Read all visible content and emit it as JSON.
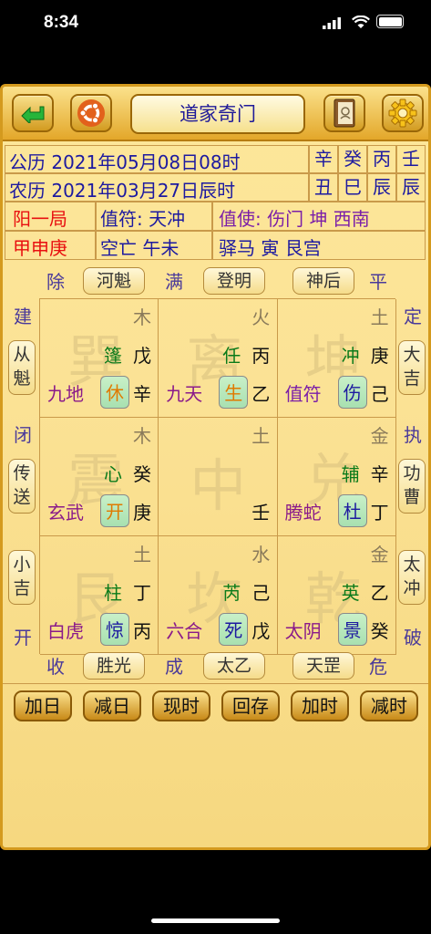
{
  "status": {
    "time": "8:34"
  },
  "title": "道家奇门",
  "row1": {
    "label": "公历 2021年05月08日08时",
    "c1": "辛",
    "c2": "癸",
    "c3": "丙",
    "c4": "壬"
  },
  "row2": {
    "label": "农历 2021年03月27日辰时",
    "c1": "丑",
    "c2": "巳",
    "c3": "辰",
    "c4": "辰"
  },
  "row3": {
    "ju": "阳一局",
    "zhifu": "值符: 天冲",
    "zhishi": "值使: 伤门 坤 西南"
  },
  "row4": {
    "xun": "甲申庚",
    "kongwang": "空亡 午未",
    "yima": "驿马 寅 艮宫"
  },
  "top": {
    "l1": "除",
    "b1": "河魁",
    "l2": "满",
    "b2": "登明",
    "b3": "神后",
    "l3": "平"
  },
  "bottom": {
    "l1": "收",
    "b1": "胜光",
    "l2": "成",
    "b2": "太乙",
    "b3": "天罡",
    "l3": "危"
  },
  "left": {
    "t1": "建",
    "b1": "从魁",
    "t2": "闭",
    "b2": "传送",
    "b3": "小吉",
    "t3": "开"
  },
  "right": {
    "t1": "定",
    "b1": "大吉",
    "t2": "执",
    "b2": "功曹",
    "b3": "太冲",
    "t3": "破"
  },
  "palaces": [
    {
      "wm": "巽",
      "el": "木",
      "star": "篷",
      "tg": "戊",
      "god": "九地",
      "door": "休",
      "dg": "辛",
      "doorColor": "#e07a00"
    },
    {
      "wm": "离",
      "el": "火",
      "star": "任",
      "tg": "丙",
      "god": "九天",
      "door": "生",
      "dg": "乙",
      "doorColor": "#e07a00"
    },
    {
      "wm": "坤",
      "el": "土",
      "star": "冲",
      "tg": "庚",
      "god": "值符",
      "door": "伤",
      "dg": "己",
      "doorColor": "#1d1aa0"
    },
    {
      "wm": "震",
      "el": "木",
      "star": "心",
      "tg": "癸",
      "god": "玄武",
      "door": "开",
      "dg": "庚",
      "doorColor": "#e07a00"
    },
    {
      "wm": "中",
      "el": "土",
      "star": "",
      "tg": "",
      "god": "",
      "door": "",
      "dg": "壬",
      "doorColor": ""
    },
    {
      "wm": "兑",
      "el": "金",
      "star": "辅",
      "tg": "辛",
      "god": "腾蛇",
      "door": "杜",
      "dg": "丁",
      "doorColor": "#1d1aa0"
    },
    {
      "wm": "艮",
      "el": "土",
      "star": "柱",
      "tg": "丁",
      "god": "白虎",
      "door": "惊",
      "dg": "丙",
      "doorColor": "#1d1aa0"
    },
    {
      "wm": "坎",
      "el": "水",
      "star": "芮",
      "tg": "己",
      "god": "六合",
      "door": "死",
      "dg": "戊",
      "doorColor": "#1d1aa0"
    },
    {
      "wm": "乾",
      "el": "金",
      "star": "英",
      "tg": "乙",
      "god": "太阴",
      "door": "景",
      "dg": "癸",
      "doorColor": "#1d1aa0"
    }
  ],
  "buttons": [
    "加日",
    "减日",
    "现时",
    "回存",
    "加时",
    "减时"
  ]
}
